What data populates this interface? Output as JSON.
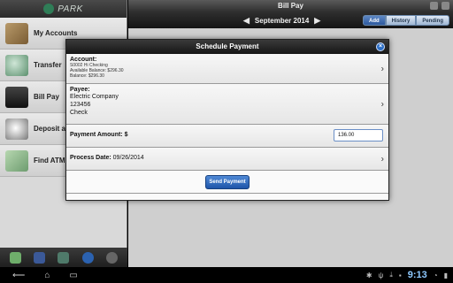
{
  "sidebar": {
    "logo_text": "PARK",
    "items": [
      {
        "label": "My Accounts"
      },
      {
        "label": "Transfer"
      },
      {
        "label": "Bill Pay"
      },
      {
        "label": "Deposit a"
      },
      {
        "label": "Find ATM"
      }
    ]
  },
  "header": {
    "title": "Bill Pay"
  },
  "month": {
    "label": "September 2014",
    "prev": "◀",
    "next": "▶"
  },
  "tabs": [
    "Add",
    "History",
    "Pending"
  ],
  "modal": {
    "title": "Schedule Payment",
    "close": "×",
    "account": {
      "label": "Account:",
      "name": "S0002 Hi Checking",
      "available": "Available Balance: $296.30",
      "balance": "Balance: $296.30"
    },
    "payee": {
      "label": "Payee:",
      "name": "Electric Company",
      "number": "123456",
      "method": "Check"
    },
    "amount": {
      "label": "Payment Amount: $",
      "value": "136.00"
    },
    "date": {
      "label": "Process Date:",
      "value": "09/26/2014"
    },
    "send_label": "Send Payment"
  },
  "system": {
    "time": "9:13"
  },
  "colors": {
    "accent": "#2e5a9e",
    "button": "#1f55a9",
    "sidebar": "#d9d9d9"
  }
}
